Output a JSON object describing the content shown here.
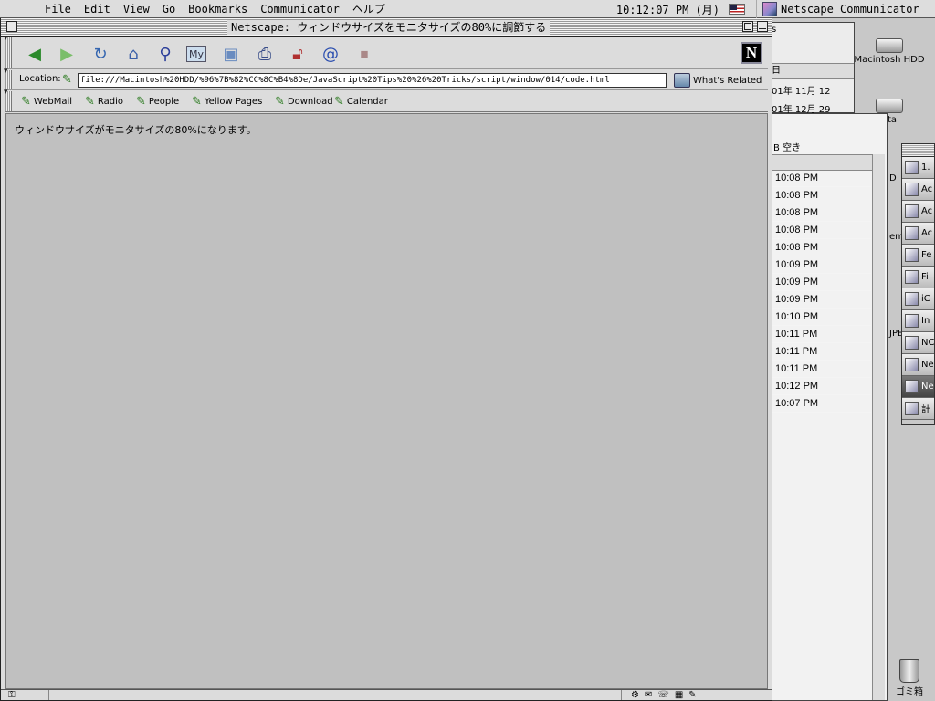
{
  "menubar": {
    "items": [
      "File",
      "Edit",
      "View",
      "Go",
      "Bookmarks",
      "Communicator",
      "ヘルプ"
    ],
    "clock": "10:12:07 PM (月)",
    "app_name": "Netscape Communicator"
  },
  "window": {
    "title": "Netscape: ウィンドウサイズをモニタサイズの80%に調節する"
  },
  "toolbar": {
    "buttons": [
      "back",
      "forward",
      "reload",
      "home",
      "search",
      "my-netscape",
      "images",
      "print",
      "security",
      "shop",
      "stop"
    ]
  },
  "location": {
    "label": "Location:",
    "url": "file:///Macintosh%20HDD/%96%7B%82%CC%8C%B4%8De/JavaScript%20Tips%20%26%20Tricks/script/window/014/code.html",
    "related_label": "What's Related"
  },
  "personal_toolbar": {
    "items": [
      "WebMail",
      "Radio",
      "People",
      "Yellow Pages",
      "Download",
      "Calendar"
    ]
  },
  "page": {
    "text": "ウィンドウサイズがモニタサイズの80%になります。"
  },
  "desktop": {
    "disk_label": "Macintosh HDD",
    "disk2_label": "ta",
    "trash_label": "ゴミ箱",
    "bg_window_header": "B 空き",
    "bg_window_dates": [
      "01年 11月 12",
      "01年 12月 29"
    ],
    "bg_window_date_header": "日",
    "bg_window_title": "s",
    "bg_list_times": [
      "10:08 PM",
      "10:08 PM",
      "10:08 PM",
      "10:08 PM",
      "10:08 PM",
      "10:09 PM",
      "10:09 PM",
      "10:09 PM",
      "10:10 PM",
      "10:11 PM",
      "10:11 PM",
      "10:11 PM",
      "10:12 PM",
      "10:07 PM"
    ],
    "palette_items": [
      "1.",
      "Ac",
      "Ac",
      "Ac",
      "Fe",
      "Fi",
      "iC",
      "In",
      "NC",
      "Ne",
      "Ne",
      "計"
    ],
    "side_fragments": [
      "D",
      "em",
      "JPE"
    ]
  }
}
